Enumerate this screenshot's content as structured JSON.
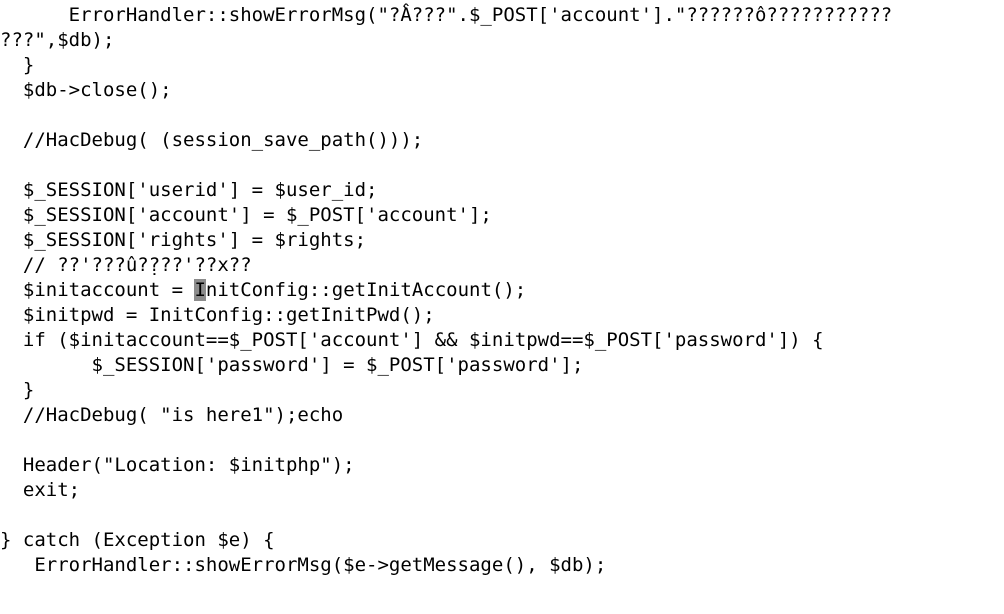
{
  "editor": {
    "lines": [
      "      ErrorHandler::showErrorMsg(\"?̀Â???\".$_POST['account'].\"??????ô???????????",
      "???\",$db);",
      "  }",
      "  $db->close();",
      "",
      "  //HacDebug( (session_save_path()));",
      "",
      "  $_SESSION['userid'] = $user_id;",
      "  $_SESSION['account'] = $_POST['account'];",
      "  $_SESSION['rights'] = $rights;",
      "  // ??'???û?̣???'??x??",
      "  $initaccount = InitConfig::getInitAccount();",
      "  $initpwd = InitConfig::getInitPwd();",
      "  if ($initaccount==$_POST['account'] && $initpwd==$_POST['password']) {",
      "        $_SESSION['password'] = $_POST['password'];",
      "  }",
      "  //HacDebug( \"is here1\");echo",
      "",
      "  Header(\"Location: $initphp\");",
      "  exit;",
      "",
      "} catch (Exception $e) {",
      "   ErrorHandler::showErrorMsg($e->getMessage(), $db);"
    ],
    "cursor": {
      "line_prefix": "  $initaccount = ",
      "char": "I",
      "line_suffix": "nitConfig::getInitAccount();"
    }
  }
}
